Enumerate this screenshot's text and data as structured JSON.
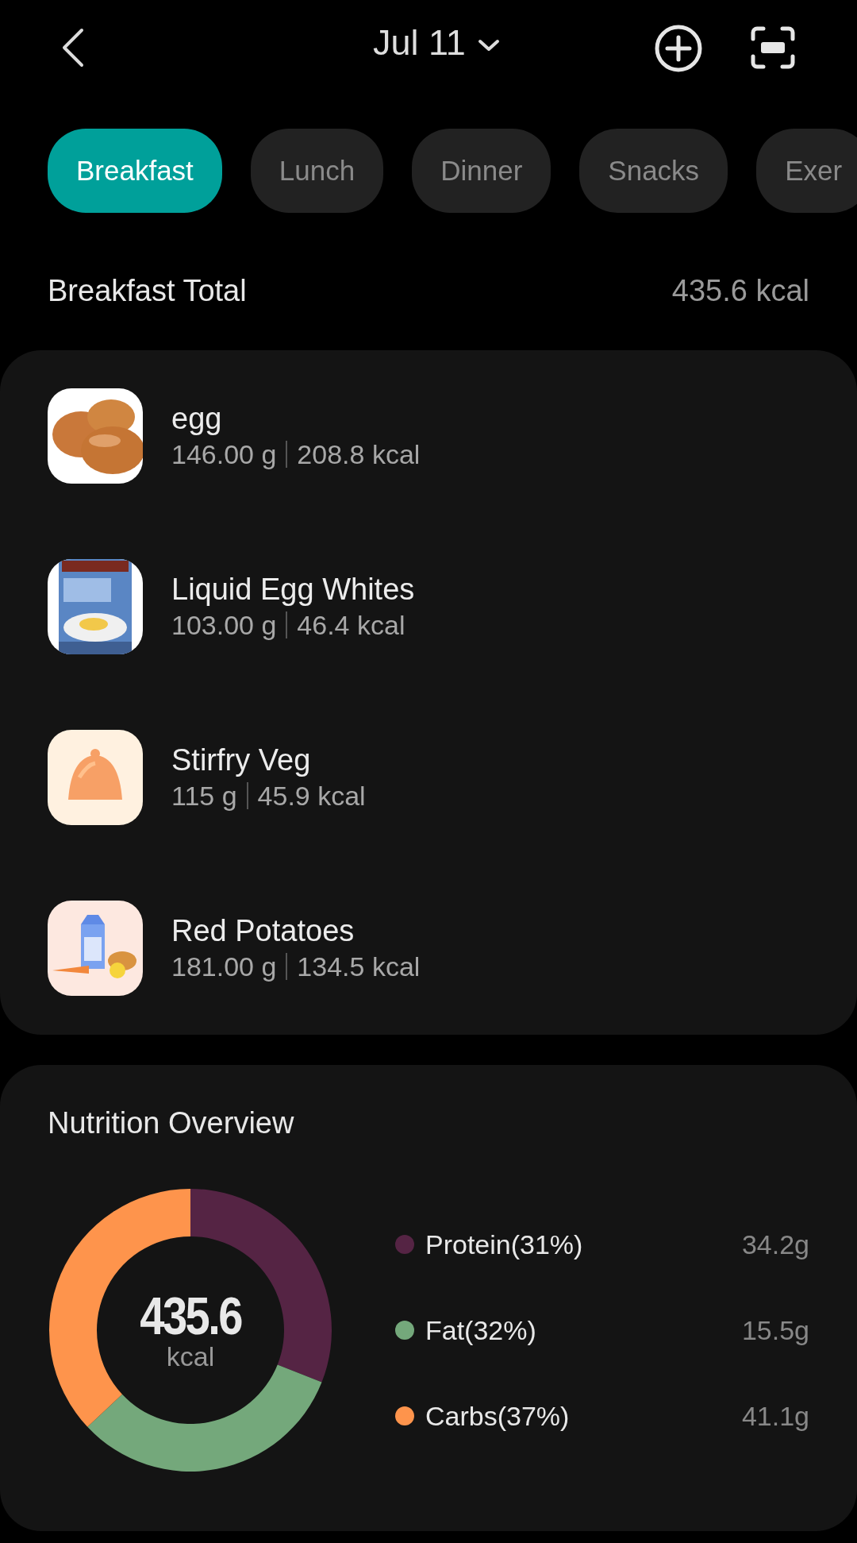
{
  "header": {
    "date": "Jul 11"
  },
  "tabs": [
    {
      "label": "Breakfast",
      "selected": true
    },
    {
      "label": "Lunch",
      "selected": false
    },
    {
      "label": "Dinner",
      "selected": false
    },
    {
      "label": "Snacks",
      "selected": false
    },
    {
      "label": "Exer",
      "selected": false
    }
  ],
  "meal_total": {
    "title": "Breakfast Total",
    "value": "435.6 kcal"
  },
  "foods": [
    {
      "name": "egg",
      "amount": "146.00 g",
      "kcal": "208.8 kcal",
      "kind": "picture"
    },
    {
      "name": "Liquid Egg Whites",
      "amount": "103.00 g",
      "kcal": "46.4 kcal",
      "kind": "picture"
    },
    {
      "name": "Stirfry Veg",
      "amount": "115  g",
      "kcal": "45.9 kcal",
      "kind": "picture"
    },
    {
      "name": "Red Potatoes",
      "amount": "181.00 g",
      "kcal": "134.5 kcal",
      "kind": "picture"
    }
  ],
  "nutrition": {
    "title": "Nutrition Overview",
    "total": "435.6",
    "unit": "kcal",
    "legend": [
      {
        "label": "Protein(31%)",
        "amount": "34.2g",
        "color": "#552444"
      },
      {
        "label": "Fat(32%)",
        "amount": "15.5g",
        "color": "#74a87b"
      },
      {
        "label": "Carbs(37%)",
        "amount": "41.1g",
        "color": "#fe944c"
      }
    ],
    "chart_data": {
      "type": "donut",
      "values": [
        31,
        32,
        37
      ]
    }
  }
}
